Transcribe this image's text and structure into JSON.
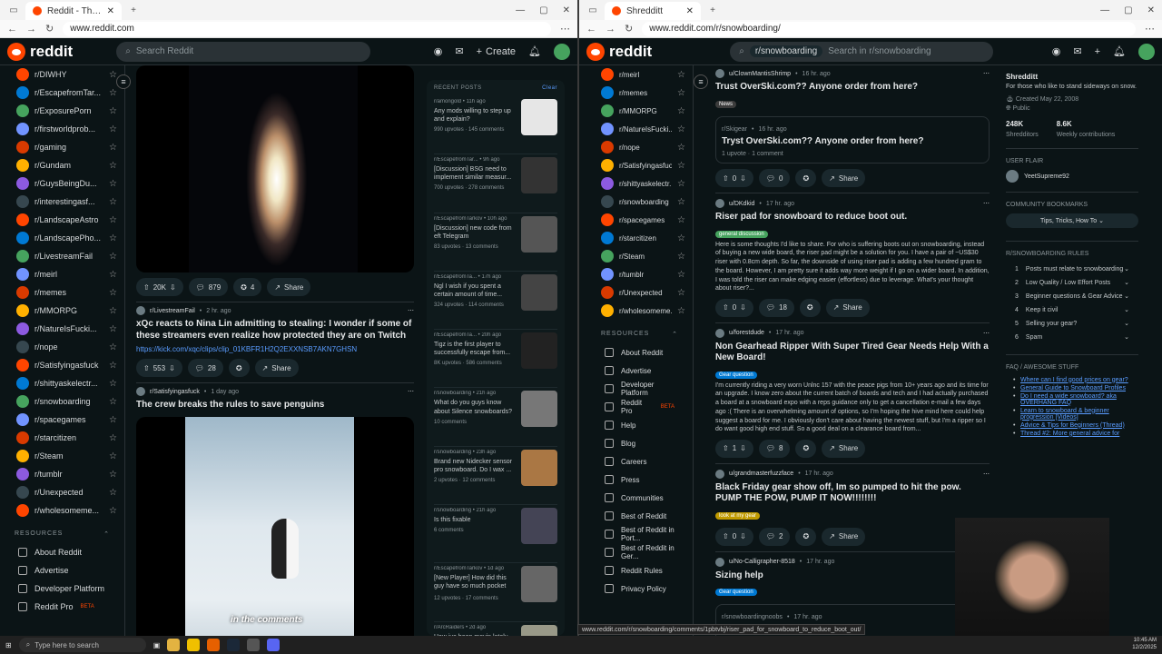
{
  "left": {
    "tab_title": "Reddit - The heart of the internet",
    "url": "www.reddit.com",
    "search_placeholder": "Search Reddit",
    "create_label": "Create",
    "sidebar": [
      "r/DIWHY",
      "r/EscapefromTar...",
      "r/ExposurePorn",
      "r/firstworldprob...",
      "r/gaming",
      "r/Gundam",
      "r/GuysBeingDu...",
      "r/interestingasf...",
      "r/LandscapeAstro",
      "r/LandscapePho...",
      "r/LivestreamFail",
      "r/meirl",
      "r/memes",
      "r/MMORPG",
      "r/NatureIsFucki...",
      "r/nope",
      "r/Satisfyingasfuck",
      "r/shittyaskelectr...",
      "r/snowboarding",
      "r/spacegames",
      "r/starcitizen",
      "r/Steam",
      "r/tumblr",
      "r/Unexpected",
      "r/wholesomeme..."
    ],
    "resources_label": "RESOURCES",
    "resources": [
      "About Reddit",
      "Advertise",
      "Developer Platform",
      "Reddit Pro"
    ],
    "beta": "BETA",
    "post1": {
      "up": "20K",
      "comments": "879",
      "awards": "4",
      "share": "Share"
    },
    "post2": {
      "sub": "r/LivestreamFail",
      "time": "2 hr. ago",
      "title": "xQc reacts to Nina Lin admitting to stealing: I wonder if some of these streamers even realize how protected they are on Twitch",
      "link": "https://kick.com/xqc/clips/clip_01KBFR1H2Q2EXXNSB7AKN7GHSN",
      "up": "553",
      "comments": "28",
      "share": "Share"
    },
    "post3": {
      "sub": "r/Satisfyingasfuck",
      "time": "1 day ago",
      "title": "The crew breaks the rules to save penguins",
      "caption": "in the comments"
    },
    "recent": {
      "header": "RECENT POSTS",
      "clear": "Clear",
      "items": [
        {
          "sub": "r/amongold",
          "time": "11h ago",
          "title": "Any mods willing to step up and explain?",
          "stats": "990 upvotes · 145 comments"
        },
        {
          "sub": "r/EscapefromTar...",
          "time": "9h ago",
          "title": "[Discussion] BSG need to implement similar measur...",
          "stats": "700 upvotes · 278 comments"
        },
        {
          "sub": "r/EscapefromTarkov",
          "time": "10h ago",
          "title": "[Discussion] new code from eft Telegram",
          "stats": "83 upvotes · 13 comments"
        },
        {
          "sub": "r/EscapefromTa...",
          "time": "17h ago",
          "title": "Ngl I wish if you spent a certain amount of time...",
          "stats": "324 upvotes · 114 comments"
        },
        {
          "sub": "r/EscapefromTa...",
          "time": "20h ago",
          "title": "Tigz is the first player to successfully escape from...",
          "stats": "8K upvotes · 586 comments"
        },
        {
          "sub": "r/snowboarding",
          "time": "21h ago",
          "title": "What do you guys know about Silence snowboards?",
          "stats": "10 comments"
        },
        {
          "sub": "r/snowboarding",
          "time": "23h ago",
          "title": "Brand new Nidecker sensor pro snowboard. Do I wax ...",
          "stats": "2 upvotes · 12 comments"
        },
        {
          "sub": "r/snowboarding",
          "time": "21h ago",
          "title": "Is this fixable",
          "stats": "6 comments"
        },
        {
          "sub": "r/EscapefromTarkov",
          "time": "1d ago",
          "title": "[New Player] How did this guy have so much pocket space?",
          "stats": "12 upvotes · 17 comments"
        },
        {
          "sub": "r/ArcRaiders",
          "time": "2d ago",
          "title": "How ive been movin lately",
          "stats": ""
        }
      ]
    }
  },
  "right": {
    "tab_title": "Shredditt",
    "url": "www.reddit.com/r/snowboarding/",
    "search_chip": "r/snowboarding",
    "search_placeholder": "Search in r/snowboarding",
    "sidebar": [
      "r/meirl",
      "r/memes",
      "r/MMORPG",
      "r/NatureIsFucki...",
      "r/nope",
      "r/Satisfyingasfuck",
      "r/shittyaskelectr...",
      "r/snowboarding",
      "r/spacegames",
      "r/starcitizen",
      "r/Steam",
      "r/tumblr",
      "r/Unexpected",
      "r/wholesomeme..."
    ],
    "resources_label": "RESOURCES",
    "resources": [
      "About Reddit",
      "Advertise",
      "Developer Platform",
      "Reddit Pro",
      "Help",
      "Blog",
      "Careers",
      "Press",
      "Communities",
      "Best of Reddit",
      "Best of Reddit in Port...",
      "Best of Reddit in Ger...",
      "Reddit Rules",
      "Privacy Policy"
    ],
    "beta": "BETA",
    "posts": [
      {
        "user": "u/ClownMantisShrimp",
        "time": "16 hr. ago",
        "title": "Trust OverSki.com?? Anyone order from here?",
        "flair": "News",
        "cross_sub": "r/Skigear",
        "cross_time": "16 hr. ago",
        "cross_title": "Tryst OverSki.com?? Anyone order from here?",
        "cross_stats": "1 upvote · 1 comment",
        "votes": "0",
        "comments": "0",
        "share": "Share"
      },
      {
        "user": "u/DKdkid",
        "time": "17 hr. ago",
        "title": "Riser pad for snowboard to reduce boot out.",
        "body": "Here is some thoughts I'd like to share. For who is suffering boots out on snowboarding, instead of buying a new wide board, the riser pad might be a solution for you. I have a pair of ~US$30 riser with 0.8cm depth. So far, the downside of using riser pad is adding a few hundred gram to the board. However, I am pretty sure it adds way more weight if I go on a wider board. In addition, I was told the riser can make edging easier (effortless) due to leverage. What's your thought about riser?...",
        "flair": "general discussion",
        "votes": "0",
        "comments": "18",
        "share": "Share"
      },
      {
        "user": "u/forestdude",
        "time": "17 hr. ago",
        "title": "Non Gearhead Ripper With Super Tired Gear Needs Help With a New Board!",
        "body": "I'm currently riding a very worn Unlnc 157 with the peace pigs from 10+ years ago and its time for an upgrade. I know zero about the current batch of boards and tech and I had actually purchased a board at a snowboard expo with a reps guidance only to get a cancellation e-mail a few days ago :( There is an overwhelming amount of options, so I'm hoping the hive mind here could help suggest a board for me. I obviously don't care about having the newest stuff, but I'm a ripper so I do want good high end stuff. So a good deal on a clearance board from...",
        "flair": "Gear question",
        "votes": "1",
        "comments": "8",
        "share": "Share"
      },
      {
        "user": "u/grandmasterfuzzface",
        "time": "17 hr. ago",
        "title": "Black Friday gear show off, Im so pumped to hit the pow. PUMP THE POW, PUMP IT NOW!!!!!!!!",
        "flair": "look at my gear",
        "votes": "0",
        "comments": "2",
        "share": "Share"
      },
      {
        "user": "u/No-Calligrapher-8518",
        "time": "17 hr. ago",
        "title": "Sizing help",
        "flair": "Gear question",
        "cross_sub": "r/snowboardingnoobs",
        "cross_time": "17 hr. ago",
        "cross_title": "Sizing help"
      }
    ],
    "about": {
      "name": "Shredditt",
      "desc": "For those who like to stand sideways on snow.",
      "created": "Created May 22, 2008",
      "visibility": "Public",
      "members": "248K",
      "members_label": "Shredditors",
      "contrib": "8.6K",
      "contrib_label": "Weekly contributions",
      "user_flair_label": "USER FLAIR",
      "user_flair": "YeetSupreme92",
      "bookmarks_label": "COMMUNITY BOOKMARKS",
      "bookmark": "Tips, Tricks, How To",
      "rules_label": "R/SNOWBOARDING RULES",
      "rules": [
        "Posts must relate to snowboarding",
        "Low Quality / Low Effort Posts",
        "Beginner questions & Gear Advice",
        "Keep it civil",
        "Selling your gear?",
        "Spam"
      ],
      "faq_label": "FAQ / AWESOME STUFF",
      "faq": [
        "Where can I find good prices on gear?",
        "General Guide to Snowboard Profiles",
        "Do I need a wide snowboard? aka OVERHANG FAQ",
        "Learn to snowboard & beginner progression [Videos]",
        "Advice & Tips for Beginners (Thread)",
        "Thread #2: More general advice for"
      ]
    },
    "status_url": "www.reddit.com/r/snowboarding/comments/1pbtvbj/riser_pad_for_snowboard_to_reduce_boot_out/"
  },
  "taskbar": {
    "search": "Type here to search",
    "time": "10:45 AM",
    "date": "12/2/2025"
  }
}
